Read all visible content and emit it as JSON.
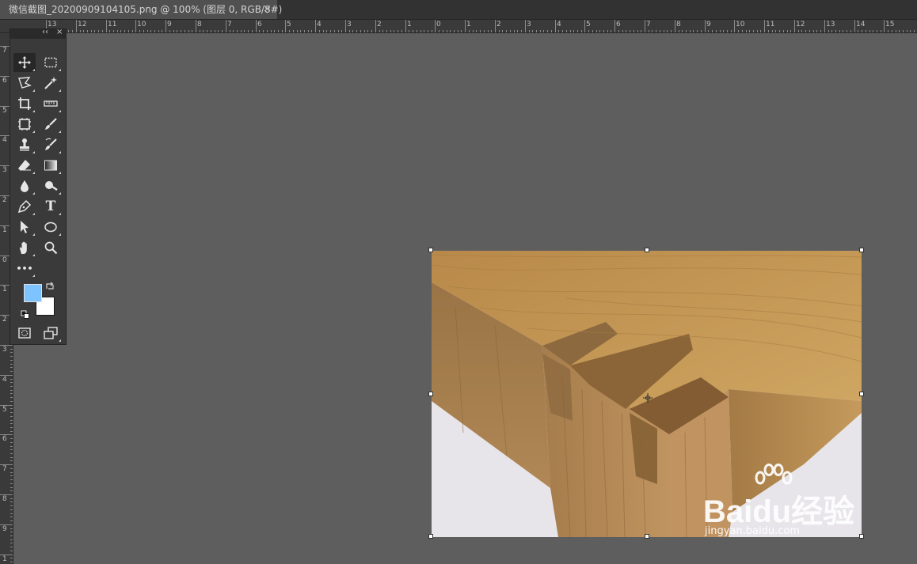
{
  "document": {
    "tab_title": "微信截图_20200909104105.png @ 100% (图层 0, RGB/8#)",
    "close_glyph": "×"
  },
  "rulers": {
    "horizontal_labels": [
      "13",
      "12",
      "11",
      "10",
      "9",
      "8",
      "7",
      "6",
      "5",
      "4",
      "3",
      "2",
      "1",
      "0",
      "1",
      "2",
      "3",
      "4",
      "5",
      "6",
      "7",
      "8",
      "9",
      "10",
      "11",
      "12",
      "13",
      "14",
      "15"
    ],
    "vertical_labels": [
      "7",
      "6",
      "5",
      "4",
      "3",
      "2",
      "1",
      "0",
      "1",
      "2",
      "3",
      "4",
      "5",
      "6",
      "7",
      "8",
      "9",
      "1"
    ]
  },
  "tools": {
    "panel_collapse_glyph": "‹‹",
    "panel_close_glyph": "×",
    "items": [
      {
        "name": "move-tool-icon",
        "active": true
      },
      {
        "name": "rectangular-marquee-tool-icon"
      },
      {
        "name": "polygonal-lasso-tool-icon"
      },
      {
        "name": "magic-wand-tool-icon"
      },
      {
        "name": "crop-tool-icon"
      },
      {
        "name": "ruler-tool-icon"
      },
      {
        "name": "frame-tool-icon"
      },
      {
        "name": "brush-tool-icon"
      },
      {
        "name": "clone-stamp-tool-icon"
      },
      {
        "name": "history-brush-tool-icon"
      },
      {
        "name": "eraser-tool-icon"
      },
      {
        "name": "gradient-tool-icon"
      },
      {
        "name": "blur-tool-icon"
      },
      {
        "name": "dodge-tool-icon"
      },
      {
        "name": "pen-tool-icon"
      },
      {
        "name": "type-tool-icon"
      },
      {
        "name": "path-selection-tool-icon"
      },
      {
        "name": "ellipse-tool-icon"
      },
      {
        "name": "hand-tool-icon"
      },
      {
        "name": "zoom-tool-icon"
      },
      {
        "name": "edit-toolbar-icon"
      },
      {
        "name": "quick-mask-icon"
      },
      {
        "name": "screen-mode-icon"
      }
    ],
    "type_tool_glyph": "T",
    "more_glyph": "•••"
  },
  "colors": {
    "foreground": "#7cc3ff",
    "background": "#ffffff",
    "workspace": "#5e5e5e",
    "panel": "#3a3a3a"
  },
  "watermark": {
    "brand": "Baidu经验",
    "url": "jingyan.baidu.com"
  }
}
